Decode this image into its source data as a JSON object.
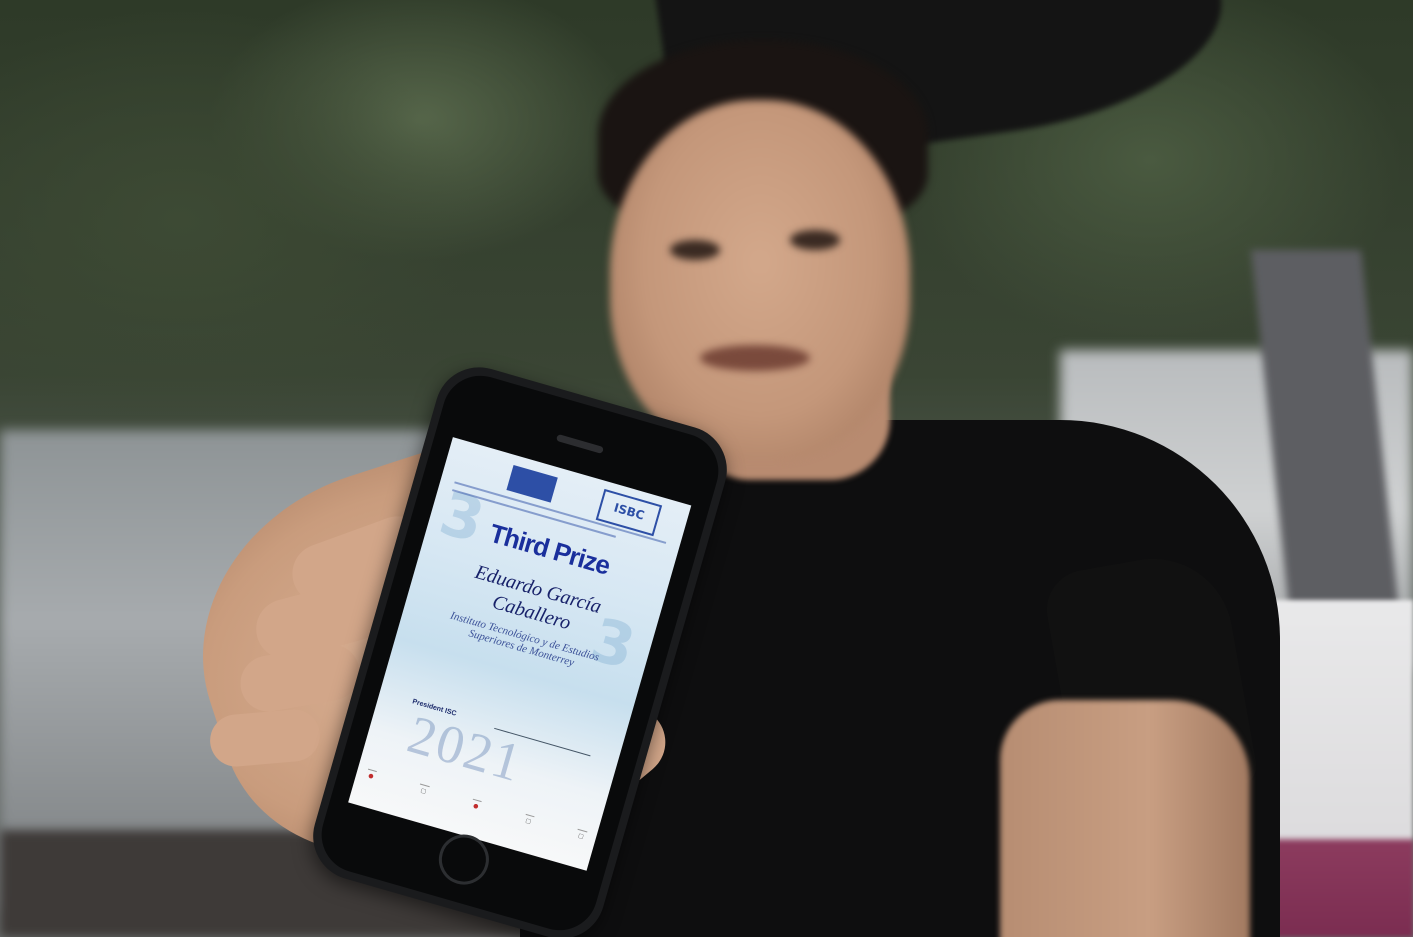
{
  "certificate": {
    "prize": "Third Prize",
    "name_line1": "Eduardo García",
    "name_line2": "Caballero",
    "institution": "Instituto Tecnológico y de Estudios Superiores de Monterrey",
    "president_label": "President ISC",
    "year": "2021",
    "logo_text": "ISBC"
  }
}
